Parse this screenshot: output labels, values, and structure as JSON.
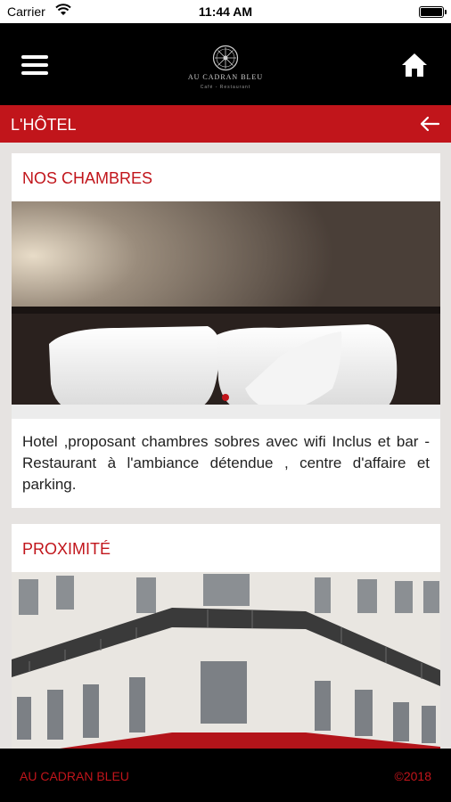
{
  "status_bar": {
    "carrier": "Carrier",
    "time": "11:44 AM"
  },
  "header": {
    "logo_name": "AU CADRAN BLEU",
    "logo_subtitle": "Café - Restaurant"
  },
  "section": {
    "title": "L'HÔTEL"
  },
  "cards": [
    {
      "title": "NOS CHAMBRES",
      "description": "Hotel ,proposant chambres sobres avec wifi Inclus et bar - Restaurant à l'ambiance détendue , centre d'affaire et parking."
    },
    {
      "title": "PROXIMITÉ"
    }
  ],
  "footer": {
    "brand": "AU CADRAN BLEU",
    "copyright": "©2018"
  },
  "colors": {
    "accent": "#c1151b",
    "header_bg": "#000000",
    "page_bg": "#e6e3e1"
  }
}
